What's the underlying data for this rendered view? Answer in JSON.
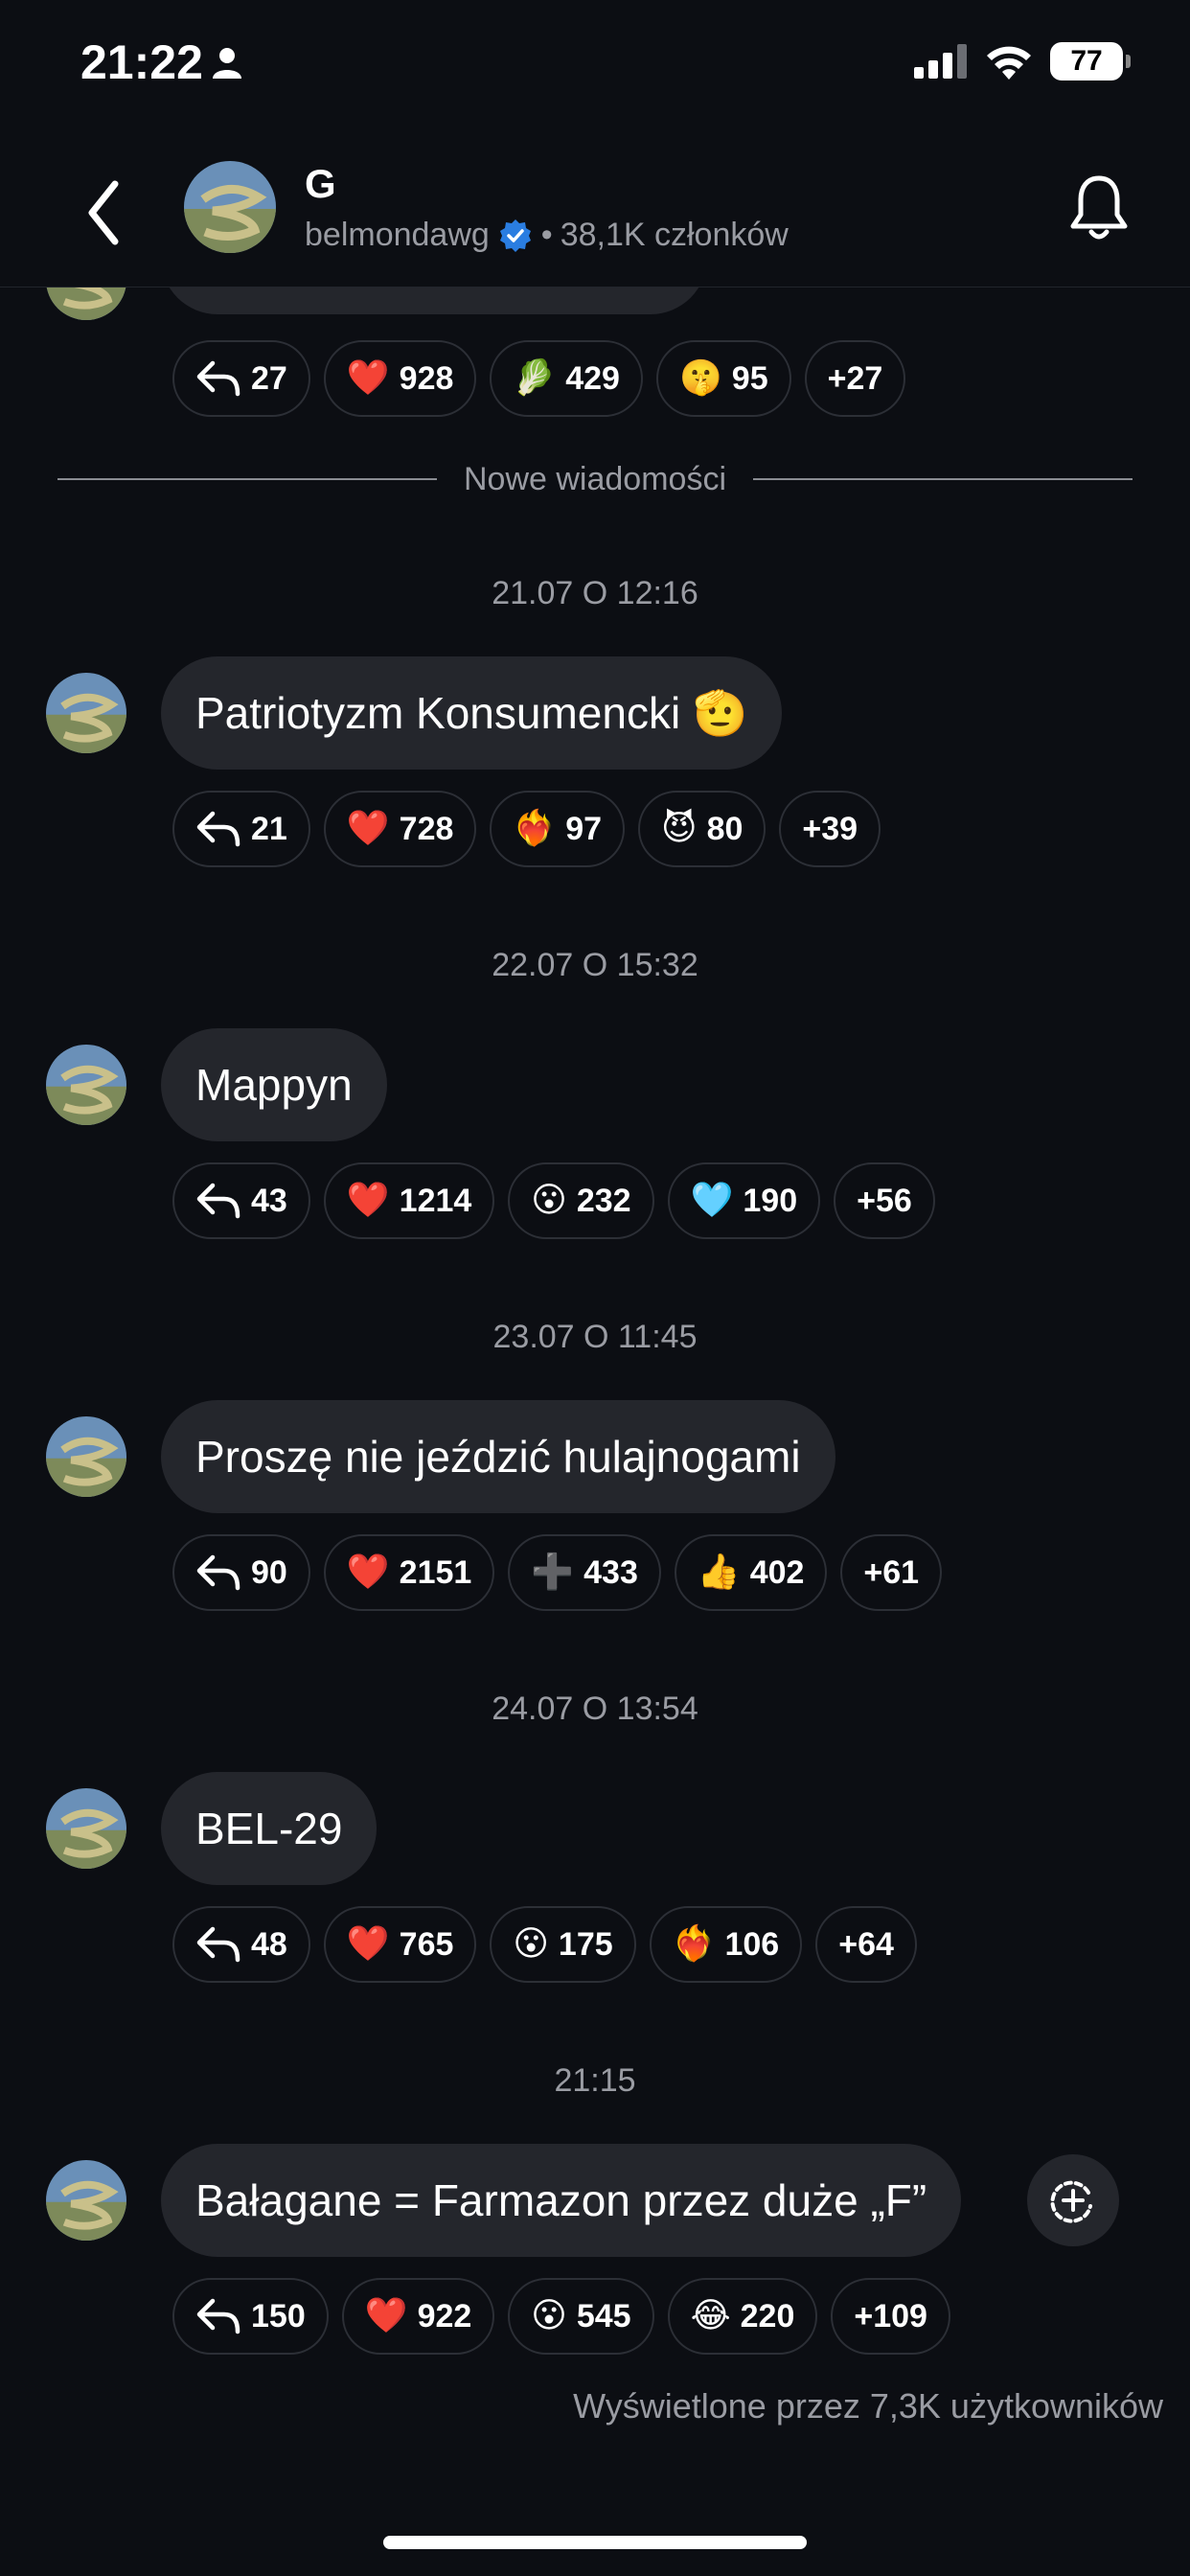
{
  "status_bar": {
    "time": "21:22",
    "battery": "77"
  },
  "header": {
    "title": "G",
    "username": "belmondawg",
    "separator": "•",
    "members": "38,1K członków"
  },
  "feed": {
    "first_reactions": [
      {
        "emoji": "↩",
        "icon": "reply-icon",
        "count": "27"
      },
      {
        "emoji": "❤️",
        "icon": "heart-icon",
        "count": "928"
      },
      {
        "emoji": "🥬",
        "icon": "leafy-greens-icon",
        "count": "429"
      },
      {
        "emoji": "🤫",
        "icon": "shush-icon",
        "count": "95"
      },
      {
        "emoji": "",
        "icon": "",
        "count": "+27"
      }
    ],
    "new_messages_label": "Nowe wiadomości",
    "posts": [
      {
        "date": "21.07 O 12:16",
        "text": "Patriotyzm Konsumencki 🫡",
        "reactions": [
          {
            "emoji": "↩",
            "icon": "reply-icon",
            "count": "21"
          },
          {
            "emoji": "❤️",
            "icon": "heart-icon",
            "count": "728"
          },
          {
            "emoji": "❤️‍🔥",
            "icon": "heart-on-fire-icon",
            "count": "97"
          },
          {
            "emoji": "😈",
            "icon": "devil-icon",
            "count": "80"
          },
          {
            "emoji": "",
            "icon": "",
            "count": "+39"
          }
        ]
      },
      {
        "date": "22.07 O 15:32",
        "text": "Mappyn",
        "reactions": [
          {
            "emoji": "↩",
            "icon": "reply-icon",
            "count": "43"
          },
          {
            "emoji": "❤️",
            "icon": "heart-icon",
            "count": "1214"
          },
          {
            "emoji": "😮",
            "icon": "surprised-icon",
            "count": "232"
          },
          {
            "emoji": "🩵",
            "icon": "light-blue-heart-icon",
            "count": "190"
          },
          {
            "emoji": "",
            "icon": "",
            "count": "+56"
          }
        ]
      },
      {
        "date": "23.07 O 11:45",
        "text": "Proszę nie jeździć hulajnogami",
        "reactions": [
          {
            "emoji": "↩",
            "icon": "reply-icon",
            "count": "90"
          },
          {
            "emoji": "❤️",
            "icon": "heart-icon",
            "count": "2151"
          },
          {
            "emoji": "➕",
            "icon": "plus-icon",
            "count": "433"
          },
          {
            "emoji": "👍",
            "icon": "thumbs-up-icon",
            "count": "402"
          },
          {
            "emoji": "",
            "icon": "",
            "count": "+61"
          }
        ]
      },
      {
        "date": "24.07 O 13:54",
        "text": "BEL-29",
        "reactions": [
          {
            "emoji": "↩",
            "icon": "reply-icon",
            "count": "48"
          },
          {
            "emoji": "❤️",
            "icon": "heart-icon",
            "count": "765"
          },
          {
            "emoji": "😮",
            "icon": "surprised-icon",
            "count": "175"
          },
          {
            "emoji": "❤️‍🔥",
            "icon": "heart-on-fire-icon",
            "count": "106"
          },
          {
            "emoji": "",
            "icon": "",
            "count": "+64"
          }
        ]
      },
      {
        "date": "21:15",
        "text": "Bałagane = Farmazon przez duże „F”",
        "reactions": [
          {
            "emoji": "↩",
            "icon": "reply-icon",
            "count": "150"
          },
          {
            "emoji": "❤️",
            "icon": "heart-icon",
            "count": "922"
          },
          {
            "emoji": "😮",
            "icon": "surprised-icon",
            "count": "545"
          },
          {
            "emoji": "😂",
            "icon": "laughing-icon",
            "count": "220"
          },
          {
            "emoji": "",
            "icon": "",
            "count": "+109"
          }
        ]
      }
    ],
    "views_label": "Wyświetlone przez 7,3K użytkowników"
  },
  "colors": {
    "background": "#0c0e13",
    "bubble": "#24262c",
    "secondary_text": "#9a9ca3",
    "verified": "#2a7de1"
  }
}
